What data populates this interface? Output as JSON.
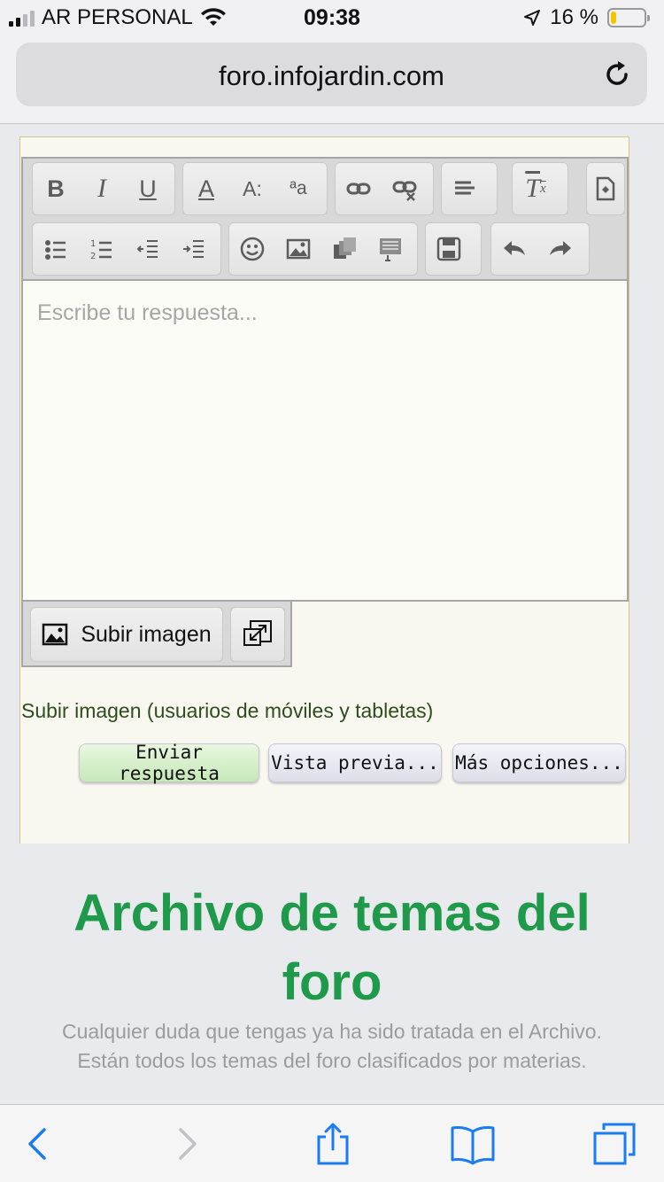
{
  "status_bar": {
    "carrier": "AR PERSONAL",
    "time": "09:38",
    "battery": "16 %",
    "battery_level": 0.16
  },
  "browser": {
    "domain": "foro.infojardin.com"
  },
  "editor": {
    "placeholder": "Escribe tu respuesta...",
    "toolbar_row1": [
      "bold-icon",
      "italic-icon",
      "underline-icon",
      "font-color-icon",
      "font-size-icon",
      "font-family-icon",
      "link-icon",
      "unlink-icon",
      "align-icon",
      "remove-format-icon",
      "source-icon"
    ],
    "toolbar_row2": [
      "bullet-list-icon",
      "numbered-list-icon",
      "outdent-icon",
      "indent-icon",
      "smiley-icon",
      "image-icon",
      "media-icon",
      "code-icon",
      "save-icon",
      "undo-icon",
      "redo-icon"
    ],
    "upload_label": "Subir imagen"
  },
  "mobile_upload_link": "Subir imagen (usuarios de móviles y tabletas)",
  "buttons": {
    "submit": "Enviar respuesta",
    "preview": "Vista previa...",
    "more": "Más opciones..."
  },
  "colors": {
    "accent": "#1e9a4a",
    "submit_bg": "#d8f0d0",
    "button_bg": "#e8e8f2"
  },
  "archive": {
    "title": "Archivo de temas del foro",
    "description": "Cualquier duda que tengas ya ha sido tratada en el Archivo. Están todos los temas del foro clasificados por materias."
  },
  "bottom_nav": [
    "back-icon",
    "forward-icon",
    "share-icon",
    "bookmarks-icon",
    "tabs-icon"
  ]
}
